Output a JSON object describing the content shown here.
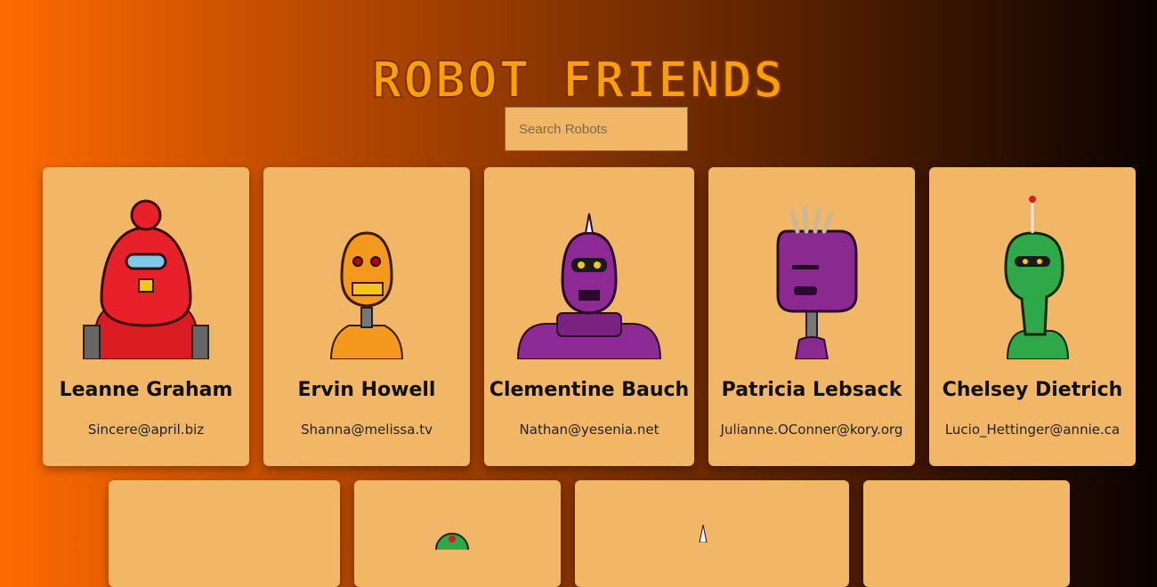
{
  "app": {
    "title": "ROBOT FRIENDS"
  },
  "search": {
    "placeholder": "Search Robots",
    "value": ""
  },
  "robots": [
    {
      "name": "Leanne Graham",
      "email": "Sincere@april.biz",
      "color": "#e8202a"
    },
    {
      "name": "Ervin Howell",
      "email": "Shanna@melissa.tv",
      "color": "#f39a1e"
    },
    {
      "name": "Clementine Bauch",
      "email": "Nathan@yesenia.net",
      "color": "#8e2a96"
    },
    {
      "name": "Patricia Lebsack",
      "email": "Julianne.OConner@kory.org",
      "color": "#8a2a90"
    },
    {
      "name": "Chelsey Dietrich",
      "email": "Lucio_Hettinger@annie.ca",
      "color": "#2fa84a"
    }
  ],
  "colors": {
    "card_bg": "#f1b766",
    "title": "#ffa000"
  }
}
